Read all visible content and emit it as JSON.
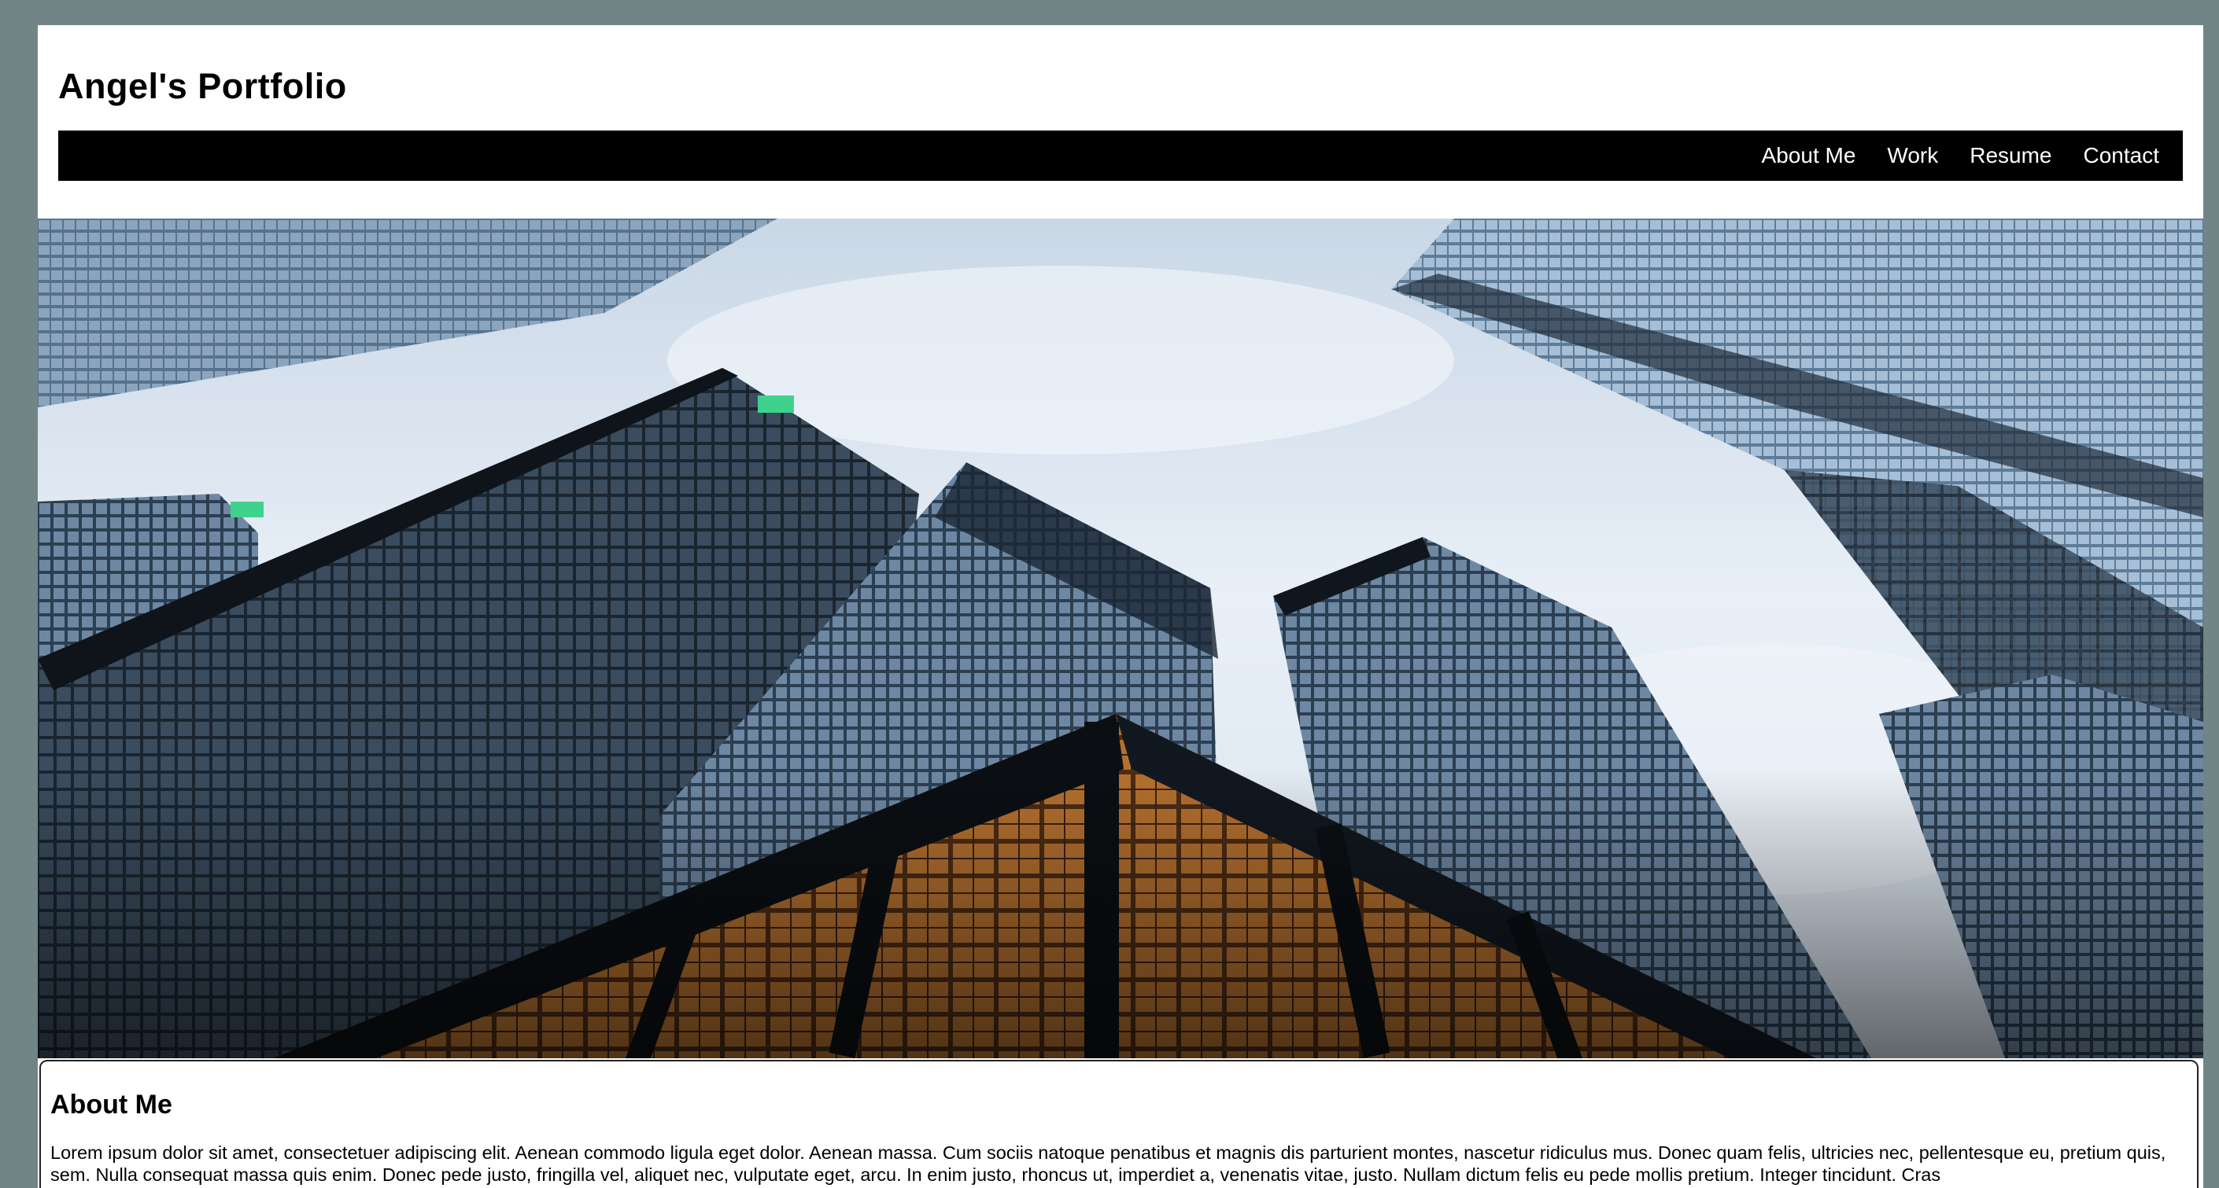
{
  "site": {
    "title": "Angel's Portfolio"
  },
  "nav": {
    "items": [
      {
        "label": "About Me"
      },
      {
        "label": "Work"
      },
      {
        "label": "Resume"
      },
      {
        "label": "Contact"
      }
    ]
  },
  "hero": {
    "image_icon": "city-skyscrapers-image"
  },
  "about": {
    "heading": "About Me",
    "body": "Lorem ipsum dolor sit amet, consectetuer adipiscing elit. Aenean commodo ligula eget dolor. Aenean massa. Cum sociis natoque penatibus et magnis dis parturient montes, nascetur ridiculus mus. Donec quam felis, ultricies nec, pellentesque eu, pretium quis, sem. Nulla consequat massa quis enim. Donec pede justo, fringilla vel, aliquet nec, vulputate eget, arcu. In enim justo, rhoncus ut, imperdiet a, venenatis vitae, justo. Nullam dictum felis eu pede mollis pretium. Integer tincidunt. Cras"
  },
  "colors": {
    "page_background": "#718587",
    "navbar": "#000000",
    "nav_text": "#ffffff",
    "content_background": "#ffffff"
  }
}
